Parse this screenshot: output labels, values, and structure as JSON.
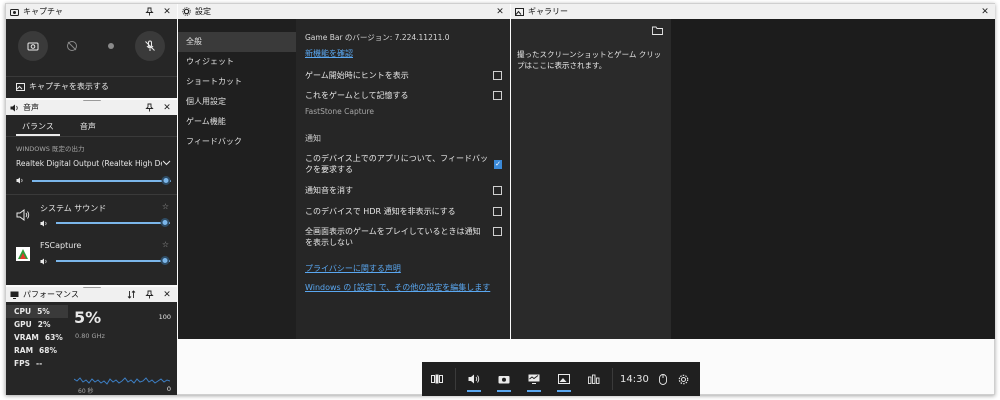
{
  "capture": {
    "title": "キャプチャ",
    "show_label": "キャプチャを表示する"
  },
  "audio": {
    "title": "音声",
    "tabs": [
      "バランス",
      "音声"
    ],
    "output_header": "WINDOWS 既定の出力",
    "device": "Realtek Digital Output (Realtek High Defi...",
    "master_volume": 1.0,
    "apps": [
      {
        "name": "システム サウンド",
        "volume": 1.0
      },
      {
        "name": "FSCapture",
        "volume": 1.0
      }
    ]
  },
  "performance": {
    "title": "パフォーマンス",
    "rows": [
      {
        "label": "CPU",
        "value": "5%"
      },
      {
        "label": "GPU",
        "value": "2%"
      },
      {
        "label": "VRAM",
        "value": "63%"
      },
      {
        "label": "RAM",
        "value": "68%"
      },
      {
        "label": "FPS",
        "value": "--"
      }
    ],
    "big_value": "5%",
    "freq": "0.80 GHz",
    "scale_max": "100",
    "scale_min": "0",
    "time_label": "60 秒"
  },
  "settings": {
    "title": "設定",
    "nav": [
      "全般",
      "ウィジェット",
      "ショートカット",
      "個人用設定",
      "ゲーム機能",
      "フィードバック"
    ],
    "version": "Game Bar のバージョン: 7.224.11211.0",
    "new_features_link": "新機能を確認",
    "options": [
      {
        "label": "ゲーム開始時にヒントを表示",
        "checked": false
      },
      {
        "label": "これをゲームとして記憶する",
        "checked": false
      }
    ],
    "app_name": "FastStone Capture",
    "notify_header": "通知",
    "notify_options": [
      {
        "label": "このデバイス上でのアプリについて、フィードバックを要求する",
        "checked": true
      },
      {
        "label": "通知音を消す",
        "checked": false
      },
      {
        "label": "このデバイスで HDR 通知を非表示にする",
        "checked": false
      },
      {
        "label": "全画面表示のゲームをプレイしているときは通知を表示しない",
        "checked": false
      }
    ],
    "privacy_link": "プライバシーに関する声明",
    "windows_link": "Windows の [設定] で、その他の設定を編集します"
  },
  "gallery": {
    "title": "ギャラリー",
    "empty_text": "撮ったスクリーンショットとゲーム クリップはここに表示されます。"
  },
  "gamebar": {
    "time": "14:30"
  },
  "colors": {
    "accent": "#5aa7f0",
    "panel": "#262626",
    "titlebar": "#f0f0f0"
  }
}
